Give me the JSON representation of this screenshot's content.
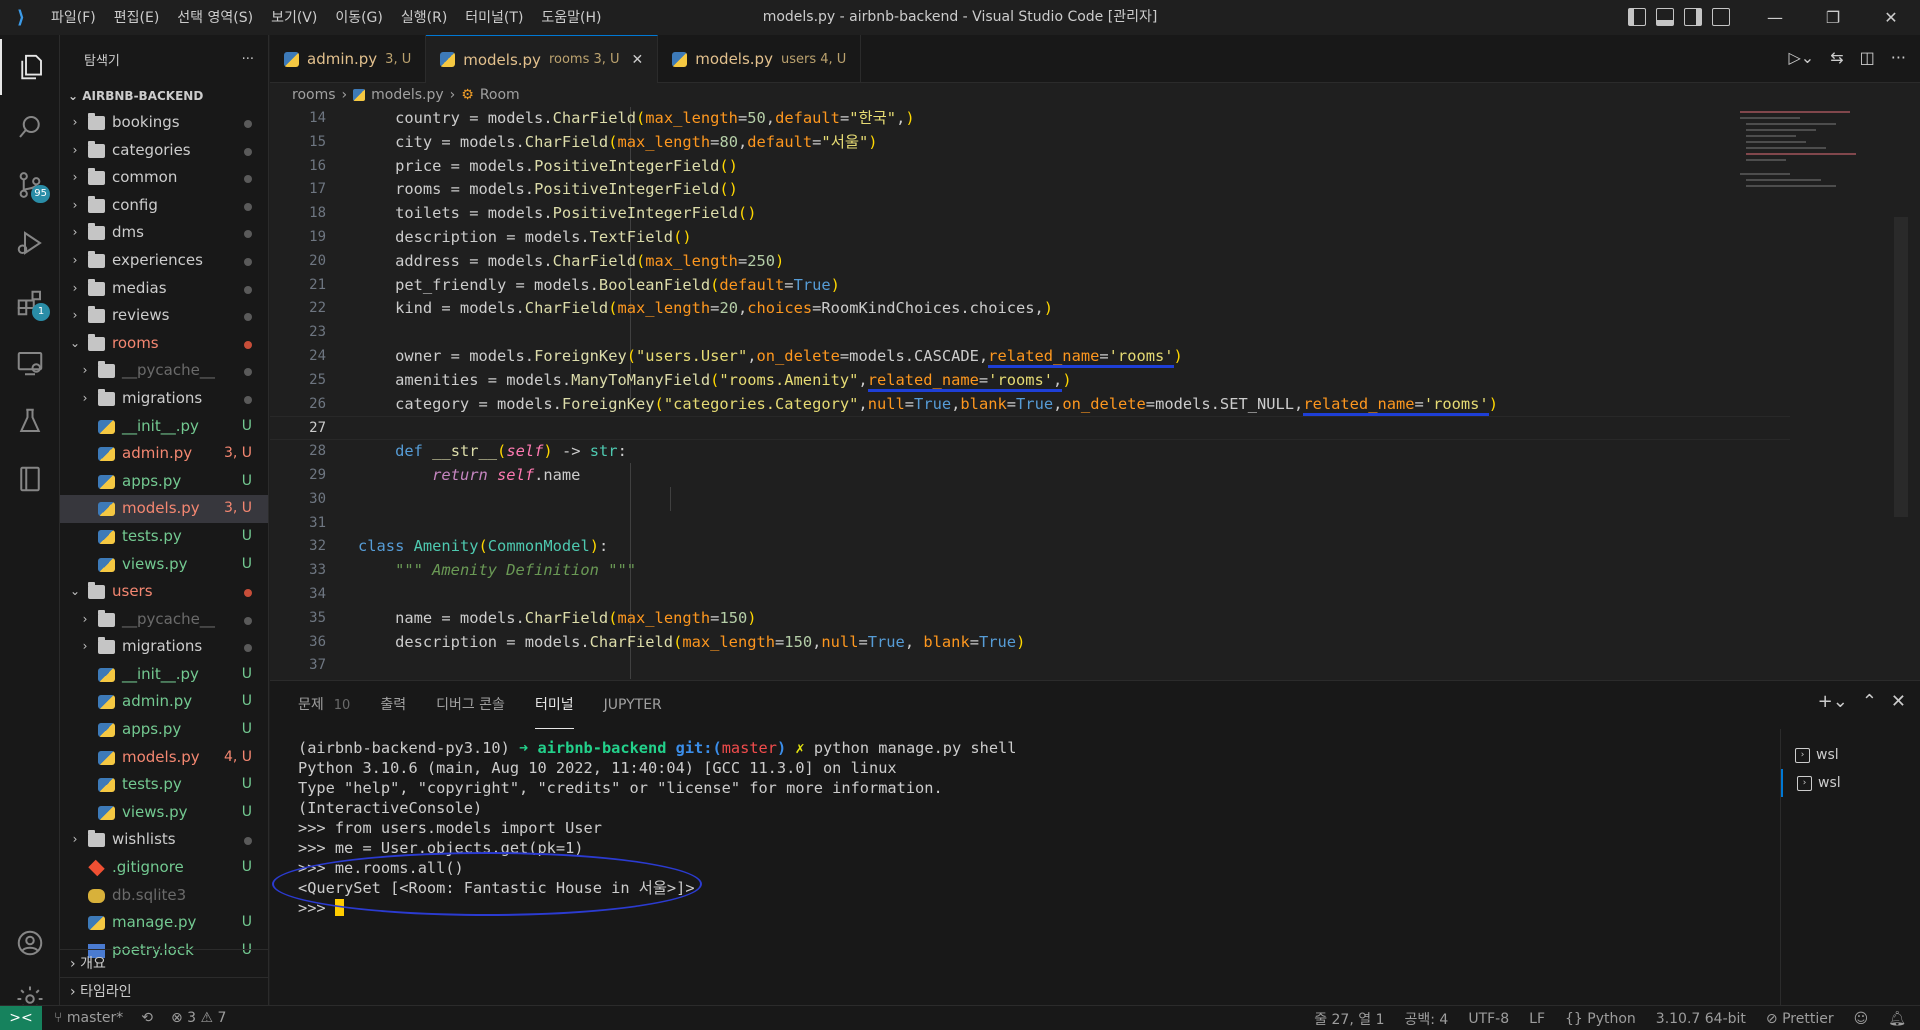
{
  "titlebar": {
    "menus": [
      "파일(F)",
      "편집(E)",
      "선택 영역(S)",
      "보기(V)",
      "이동(G)",
      "실행(R)",
      "터미널(T)",
      "도움말(H)"
    ],
    "window_title": "models.py - airbnb-backend - Visual Studio Code [관리자]"
  },
  "activity": {
    "scm_badge": "95",
    "extensions_badge": "1"
  },
  "sidebar": {
    "title": "탐색기",
    "more": "···",
    "project": "AIRBNB-BACKEND",
    "rows": [
      {
        "name": "bookings",
        "kind": "folder",
        "depth": 0,
        "open": false,
        "status": "",
        "cls": "c-normal"
      },
      {
        "name": "categories",
        "kind": "folder",
        "depth": 0,
        "open": false,
        "status": "",
        "cls": "c-normal"
      },
      {
        "name": "common",
        "kind": "folder",
        "depth": 0,
        "open": false,
        "status": "",
        "cls": "c-normal"
      },
      {
        "name": "config",
        "kind": "folder",
        "depth": 0,
        "open": false,
        "status": "",
        "cls": "c-normal"
      },
      {
        "name": "dms",
        "kind": "folder",
        "depth": 0,
        "open": false,
        "status": "",
        "cls": "c-normal"
      },
      {
        "name": "experiences",
        "kind": "folder",
        "depth": 0,
        "open": false,
        "status": "",
        "cls": "c-normal"
      },
      {
        "name": "medias",
        "kind": "folder",
        "depth": 0,
        "open": false,
        "status": "",
        "cls": "c-normal"
      },
      {
        "name": "reviews",
        "kind": "folder",
        "depth": 0,
        "open": false,
        "status": "",
        "cls": "c-normal"
      },
      {
        "name": "rooms",
        "kind": "folder",
        "depth": 0,
        "open": true,
        "status": "",
        "cls": "c-err",
        "dot": "red"
      },
      {
        "name": "__pycache__",
        "kind": "folder",
        "depth": 1,
        "open": false,
        "status": "",
        "cls": "c-dim"
      },
      {
        "name": "migrations",
        "kind": "folder",
        "depth": 1,
        "open": false,
        "status": "",
        "cls": "c-normal"
      },
      {
        "name": "__init__.py",
        "kind": "py",
        "depth": 1,
        "status": "U",
        "cls": "c-git"
      },
      {
        "name": "admin.py",
        "kind": "py",
        "depth": 1,
        "status": "3, U",
        "cls": "c-err"
      },
      {
        "name": "apps.py",
        "kind": "py",
        "depth": 1,
        "status": "U",
        "cls": "c-git"
      },
      {
        "name": "models.py",
        "kind": "py",
        "depth": 1,
        "status": "3, U",
        "cls": "c-err",
        "selected": true
      },
      {
        "name": "tests.py",
        "kind": "py",
        "depth": 1,
        "status": "U",
        "cls": "c-git"
      },
      {
        "name": "views.py",
        "kind": "py",
        "depth": 1,
        "status": "U",
        "cls": "c-git"
      },
      {
        "name": "users",
        "kind": "folder",
        "depth": 0,
        "open": true,
        "status": "",
        "cls": "c-err",
        "dot": "red"
      },
      {
        "name": "__pycache__",
        "kind": "folder",
        "depth": 1,
        "open": false,
        "status": "",
        "cls": "c-dim"
      },
      {
        "name": "migrations",
        "kind": "folder",
        "depth": 1,
        "open": false,
        "status": "",
        "cls": "c-normal"
      },
      {
        "name": "__init__.py",
        "kind": "py",
        "depth": 1,
        "status": "U",
        "cls": "c-git"
      },
      {
        "name": "admin.py",
        "kind": "py",
        "depth": 1,
        "status": "U",
        "cls": "c-git"
      },
      {
        "name": "apps.py",
        "kind": "py",
        "depth": 1,
        "status": "U",
        "cls": "c-git"
      },
      {
        "name": "models.py",
        "kind": "py",
        "depth": 1,
        "status": "4, U",
        "cls": "c-err"
      },
      {
        "name": "tests.py",
        "kind": "py",
        "depth": 1,
        "status": "U",
        "cls": "c-git"
      },
      {
        "name": "views.py",
        "kind": "py",
        "depth": 1,
        "status": "U",
        "cls": "c-git"
      },
      {
        "name": "wishlists",
        "kind": "folder",
        "depth": 0,
        "open": false,
        "status": "",
        "cls": "c-normal"
      },
      {
        "name": ".gitignore",
        "kind": "git",
        "depth": 0,
        "status": "U",
        "cls": "c-git"
      },
      {
        "name": "db.sqlite3",
        "kind": "db",
        "depth": 0,
        "status": "",
        "cls": "c-dim"
      },
      {
        "name": "manage.py",
        "kind": "py",
        "depth": 0,
        "status": "U",
        "cls": "c-git"
      },
      {
        "name": "poetry.lock",
        "kind": "file",
        "depth": 0,
        "status": "U",
        "cls": "c-git"
      }
    ],
    "outline": "개요",
    "timeline": "타임라인"
  },
  "tabs": [
    {
      "name": "admin.py",
      "desc": "3, U",
      "active": false,
      "close": ""
    },
    {
      "name": "models.py",
      "desc": "rooms 3, U",
      "active": true,
      "close": "✕"
    },
    {
      "name": "models.py",
      "desc": "users 4, U",
      "active": false,
      "close": ""
    }
  ],
  "breadcrumb": {
    "folder": "rooms",
    "file": "models.py",
    "symbol": "Room"
  },
  "editor": {
    "line_numbers": [
      "14",
      "15",
      "16",
      "17",
      "18",
      "19",
      "20",
      "21",
      "22",
      "23",
      "24",
      "25",
      "26",
      "27",
      "28",
      "29",
      "30",
      "31",
      "32",
      "33",
      "34",
      "35",
      "36",
      "37"
    ],
    "current_line": "27"
  },
  "panel": {
    "tabs": [
      "문제",
      "출력",
      "디버그 콘솔",
      "터미널",
      "JUPYTER"
    ],
    "problems_count": "10",
    "active_tab": "터미널",
    "terminals": [
      "wsl",
      "wsl"
    ],
    "prompt_env": "(airbnb-backend-py3.10)",
    "prompt_arrow": "➜",
    "prompt_dir": "airbnb-backend",
    "prompt_git": "git:(",
    "prompt_branch": "master",
    "prompt_git_end": ")",
    "prompt_x": "✗",
    "prompt_cmd": "python manage.py shell",
    "lines": [
      "Python 3.10.6 (main, Aug 10 2022, 11:40:04) [GCC 11.3.0] on linux",
      "Type \"help\", \"copyright\", \"credits\" or \"license\" for more information.",
      "(InteractiveConsole)",
      ">>> from users.models import User",
      ">>> me = User.objects.get(pk=1)",
      ">>> me.rooms.all()",
      "<QuerySet [<Room: Fantastic House in 서울>]>",
      ">>> "
    ]
  },
  "statusbar": {
    "remote": "><",
    "branch": "master*",
    "sync": "⟲",
    "errors": "3",
    "warnings": "7",
    "position": "줄 27, 열 1",
    "spaces": "공백: 4",
    "encoding": "UTF-8",
    "eol": "LF",
    "language": "Python",
    "interpreter": "3.10.7 64-bit",
    "prettier": "Prettier"
  },
  "colors": {
    "accent": "#0078d4",
    "remote": "#16825d",
    "annotation": "#2b3bd1"
  }
}
